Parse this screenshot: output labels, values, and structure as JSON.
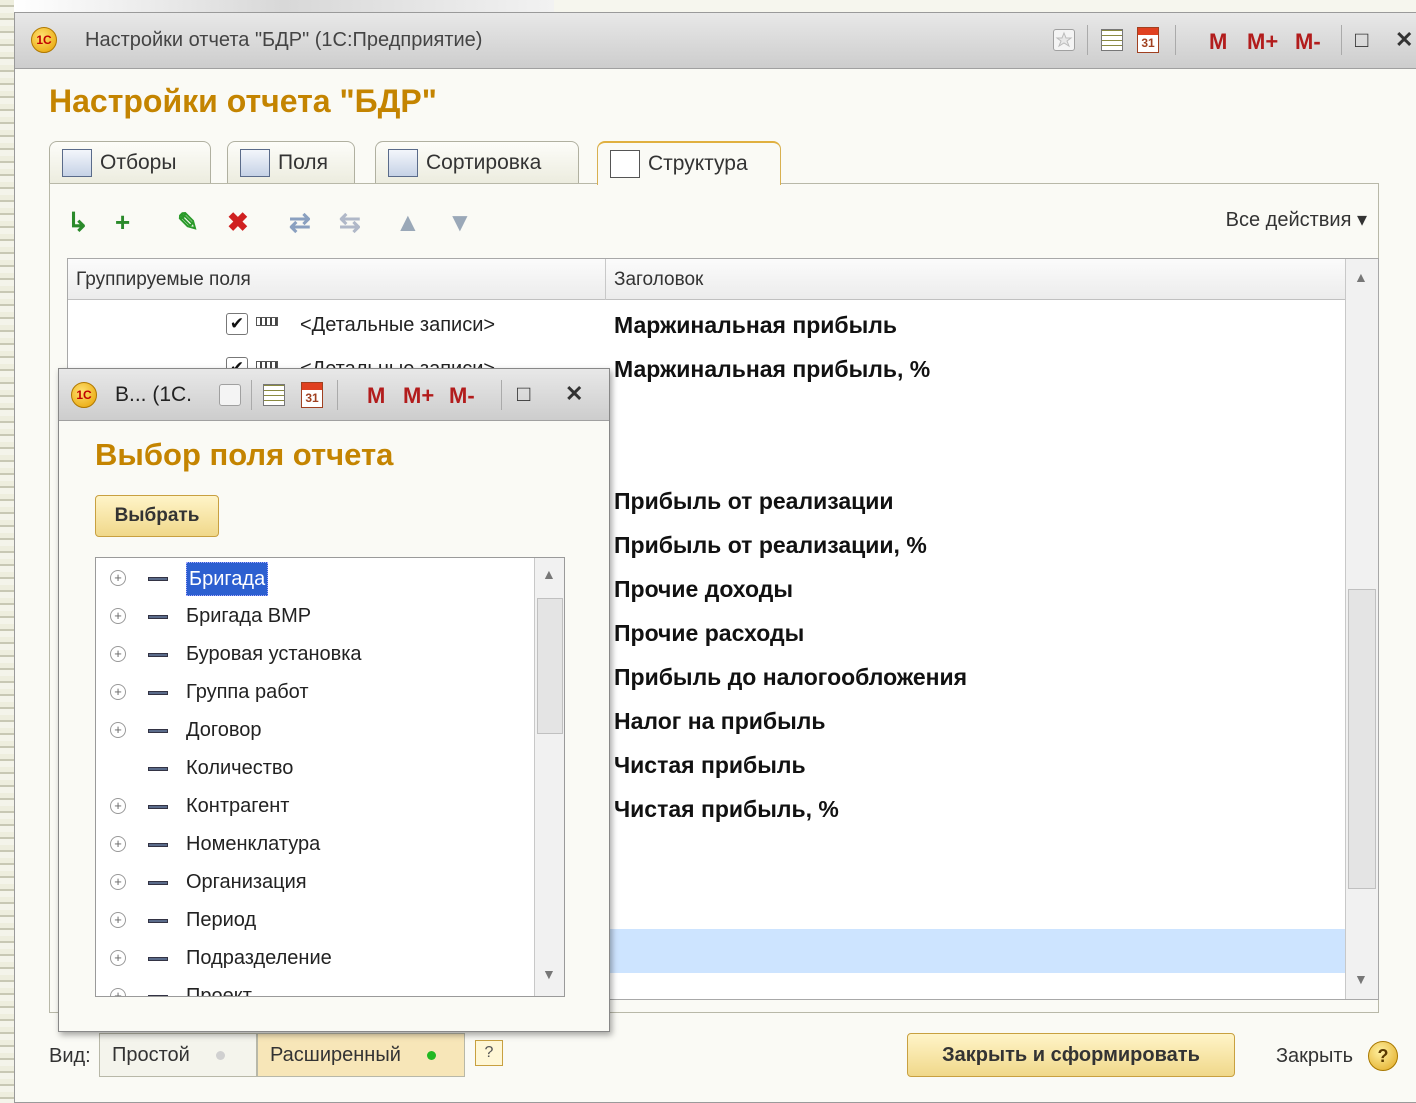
{
  "main_window": {
    "title": "Настройки отчета \"БДР\"  (1С:Предприятие)",
    "title_buttons": {
      "m": "M",
      "m_plus": "M+",
      "m_minus": "M-",
      "maximize": "□",
      "close": "✕"
    },
    "logo_text": "1С"
  },
  "form": {
    "title": "Настройки отчета \"БДР\"",
    "tabs": [
      {
        "label": "Отборы",
        "icon": "filter-table-icon"
      },
      {
        "label": "Поля",
        "icon": "fields-list-icon"
      },
      {
        "label": "Сортировка",
        "icon": "sort-icon"
      },
      {
        "label": "Структура",
        "icon": "structure-tree-icon",
        "active": true
      }
    ],
    "toolbar": {
      "icons": [
        "add-group-icon",
        "add-child-group-icon",
        "edit-pencil-icon",
        "delete-x-icon",
        "group-icon",
        "ungroup-icon",
        "move-up-icon",
        "move-down-icon"
      ],
      "all_actions": "Все действия ▾"
    },
    "grid": {
      "columns": [
        "Группируемые поля",
        "Заголовок"
      ],
      "rows": [
        {
          "field": "<Детальные записи>",
          "caption": "Маржинальная прибыль",
          "checked": true
        },
        {
          "field": "<Детальные записи>",
          "caption": "Маржинальная прибыль, %",
          "checked": true
        },
        {
          "field": "",
          "caption": ""
        },
        {
          "field": "",
          "caption": ""
        },
        {
          "field": "",
          "caption": "Прибыль от реализации"
        },
        {
          "field": "",
          "caption": "Прибыль от реализации, %"
        },
        {
          "field": "",
          "caption": "Прочие доходы"
        },
        {
          "field": "",
          "caption": "Прочие расходы"
        },
        {
          "field": "",
          "caption": "Прибыль до налогообложения"
        },
        {
          "field": "",
          "caption": "Налог на прибыль"
        },
        {
          "field": "",
          "caption": "Чистая прибыль"
        },
        {
          "field": "",
          "caption": "Чистая прибыль, %"
        }
      ]
    }
  },
  "bottom_bar": {
    "view_label": "Вид:",
    "simple": "Простой",
    "extended": "Расширенный",
    "help_small": "?",
    "submit": "Закрыть и сформировать",
    "close": "Закрыть",
    "help": "?"
  },
  "dialog": {
    "title": "В... (1С.",
    "heading": "Выбор поля отчета",
    "select_button": "Выбрать",
    "items": [
      {
        "label": "Бригада",
        "expandable": true,
        "selected": true
      },
      {
        "label": "Бригада ВМР",
        "expandable": true
      },
      {
        "label": "Буровая установка",
        "expandable": true
      },
      {
        "label": "Группа работ",
        "expandable": true
      },
      {
        "label": "Договор",
        "expandable": true
      },
      {
        "label": "Количество",
        "expandable": false
      },
      {
        "label": "Контрагент",
        "expandable": true
      },
      {
        "label": "Номенклатура",
        "expandable": true
      },
      {
        "label": "Организация",
        "expandable": true
      },
      {
        "label": "Период",
        "expandable": true
      },
      {
        "label": "Подразделение",
        "expandable": true
      },
      {
        "label": "Проект",
        "expandable": true
      }
    ]
  },
  "colors": {
    "accent_title": "#c48400",
    "selection": "#cde4ff",
    "tree_selection": "#2c5fd0",
    "button_yellow": "#f0d88a"
  }
}
